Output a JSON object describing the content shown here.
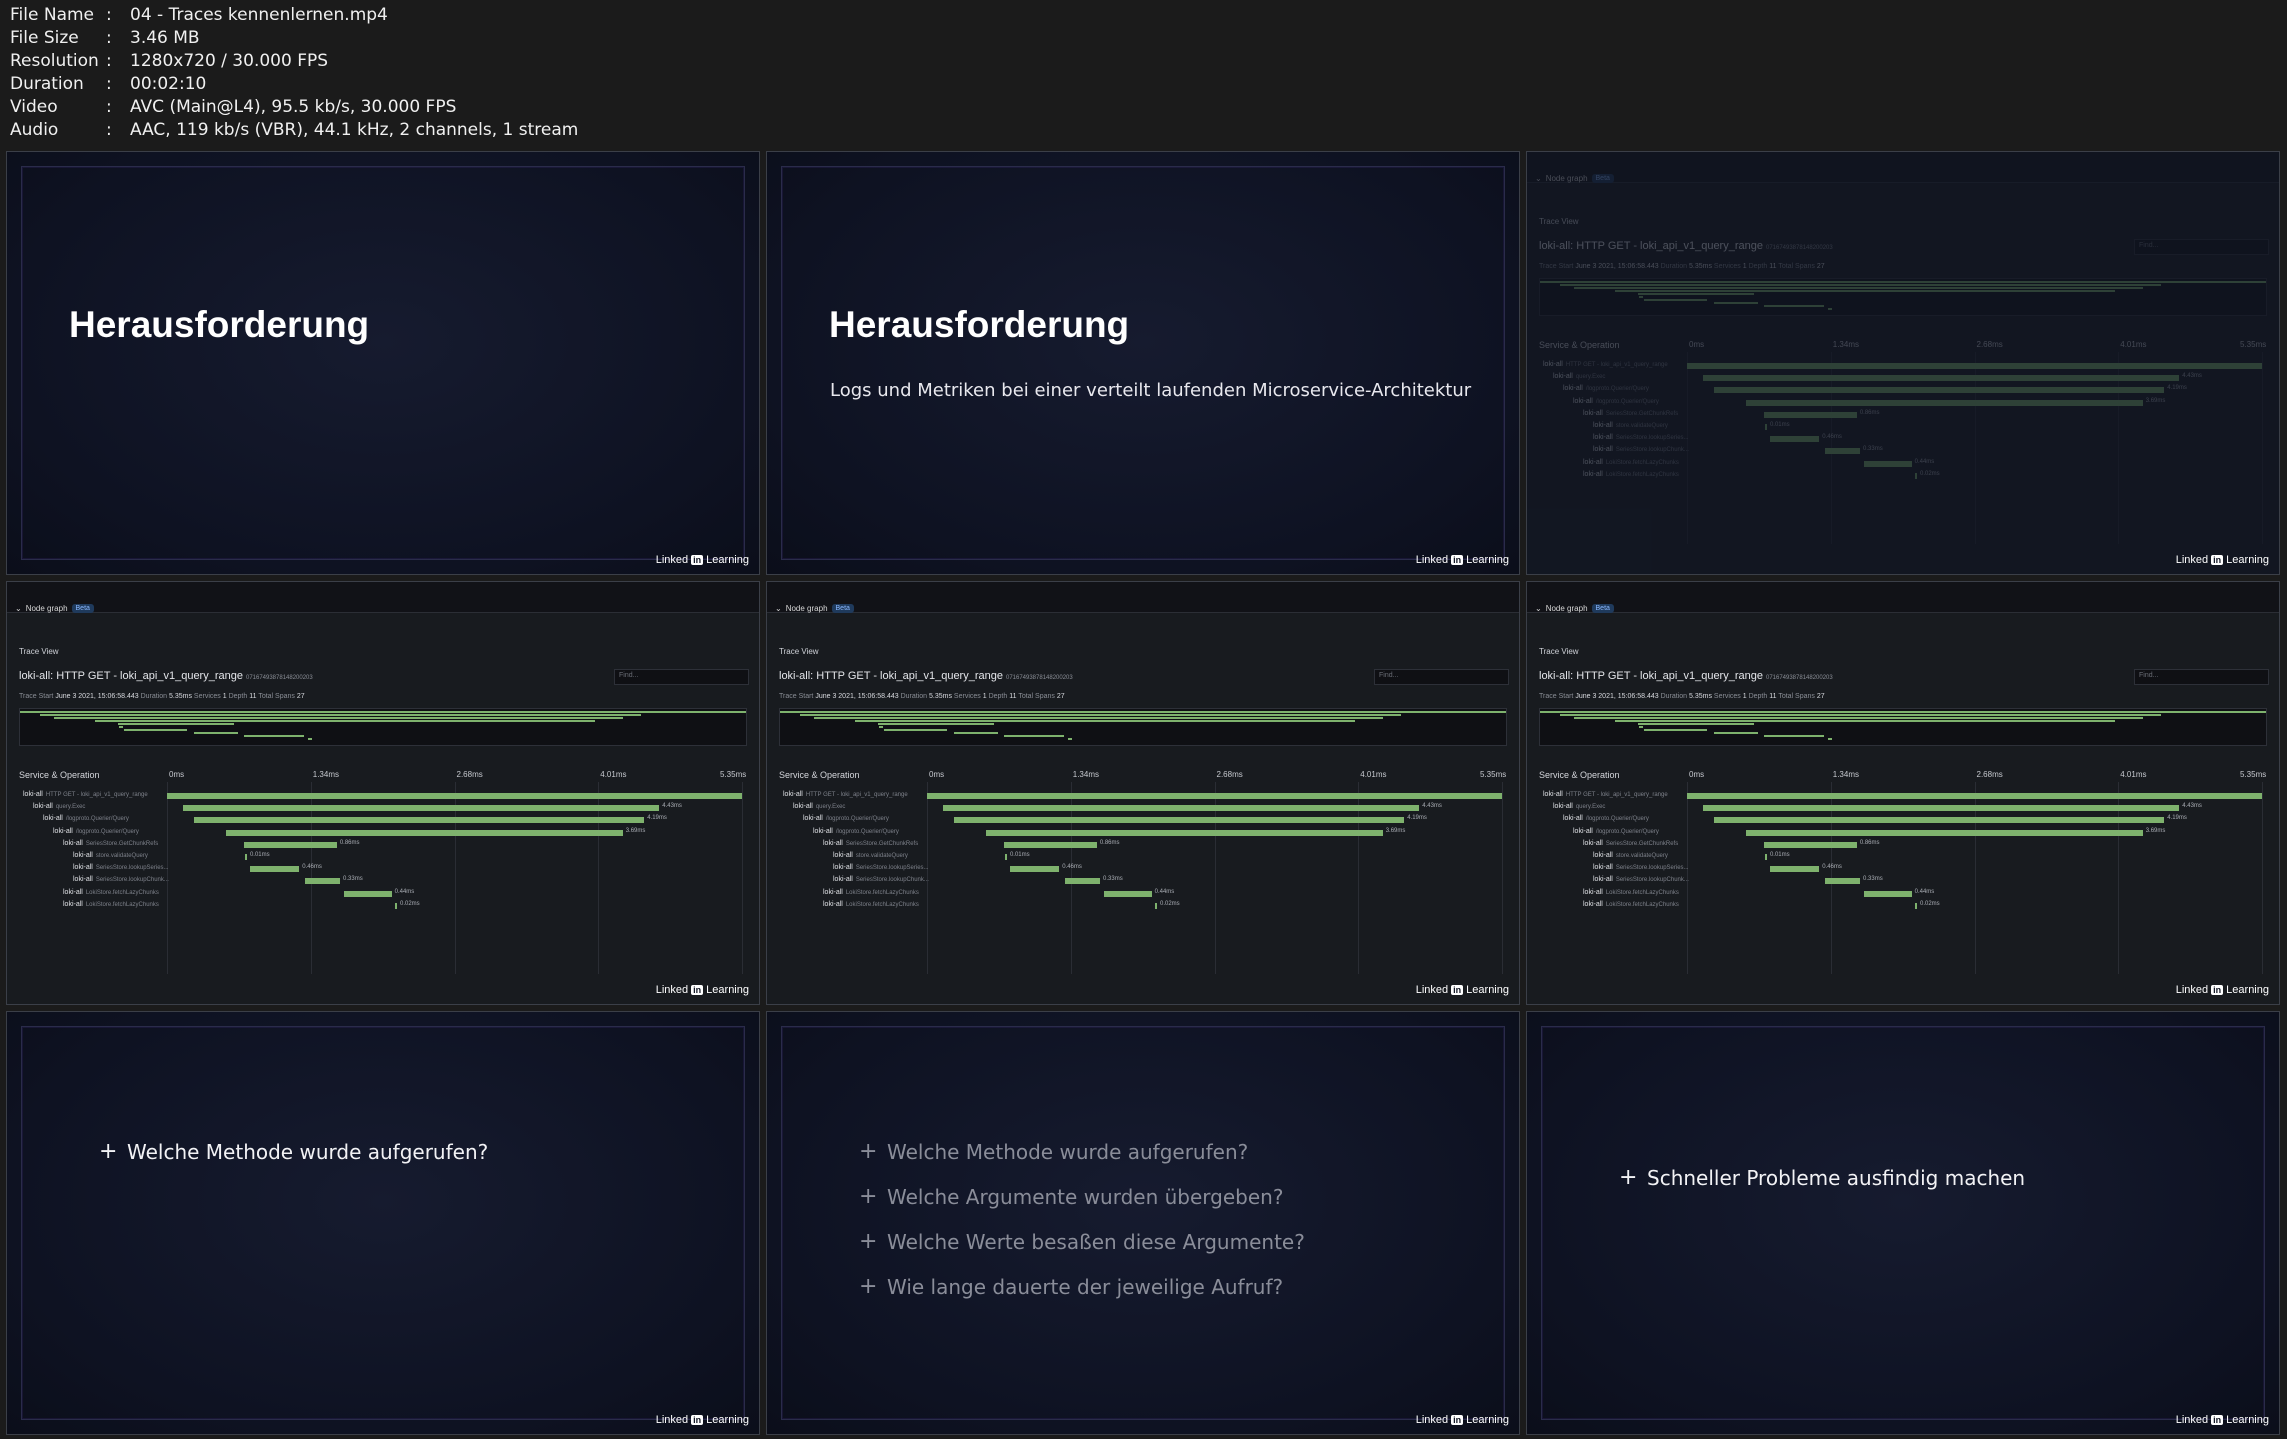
{
  "meta": {
    "rows": [
      {
        "key": "File Name",
        "sep": ":",
        "value": "04 - Traces kennenlernen.mp4"
      },
      {
        "key": "File Size",
        "sep": ":",
        "value": "3.46 MB"
      },
      {
        "key": "Resolution",
        "sep": ":",
        "value": "1280x720 / 30.000 FPS"
      },
      {
        "key": "Duration",
        "sep": ":",
        "value": "00:02:10"
      },
      {
        "key": "Video",
        "sep": ":",
        "value": "AVC (Main@L4), 95.5 kb/s, 30.000 FPS"
      },
      {
        "key": "Audio",
        "sep": ":",
        "value": "AAC, 119 kb/s (VBR), 44.1 kHz, 2 channels, 1 stream"
      }
    ]
  },
  "brand": {
    "pre": "Linked",
    "in": "in",
    "post": "Learning"
  },
  "slides": {
    "s1": {
      "heading": "Herausforderung"
    },
    "s2": {
      "heading": "Herausforderung",
      "subtitle": "Logs und Metriken bei einer verteilt laufenden Microservice-Architektur"
    },
    "s7": {
      "bullets": [
        "Welche Methode wurde aufgerufen?"
      ]
    },
    "s8": {
      "bullets": [
        "Welche Methode wurde aufgerufen?",
        "Welche Argumente wurden übergeben?",
        "Welche Werte besaßen diese Argumente?",
        "Wie lange dauerte der jeweilige Aufruf?"
      ]
    },
    "s9": {
      "bullets": [
        "Schneller Probleme ausfindig machen"
      ]
    }
  },
  "trace": {
    "node_graph": "Node graph",
    "beta": "Beta",
    "label": "Trace View",
    "title": "loki-all: HTTP GET - loki_api_v1_query_range",
    "trace_id": "07167493878148200203",
    "find_placeholder": "Find...",
    "stats": {
      "start_label": "Trace Start",
      "start": "June 3 2021, 15:06:58.443",
      "duration_label": "Duration",
      "duration": "5.35ms",
      "services_label": "Services",
      "services": "1",
      "depth_label": "Depth",
      "depth": "11",
      "spans_label": "Total Spans",
      "spans": "27"
    },
    "service_op": "Service & Operation",
    "ticks": [
      "0ms",
      "1.34ms",
      "2.68ms",
      "4.01ms",
      "5.35ms"
    ],
    "rows": [
      {
        "svc": "loki-all",
        "op": "HTTP GET - loki_api_v1_query_range",
        "start": 0.0,
        "dur": 5.35,
        "label": ""
      },
      {
        "svc": "loki-all",
        "op": "query.Exec",
        "start": 0.15,
        "dur": 4.43,
        "label": "4.43ms"
      },
      {
        "svc": "loki-all",
        "op": "/logproto.Querier/Query",
        "start": 0.25,
        "dur": 4.19,
        "label": "4.19ms"
      },
      {
        "svc": "loki-all",
        "op": "/logproto.Querier/Query",
        "start": 0.55,
        "dur": 3.69,
        "label": "3.69ms"
      },
      {
        "svc": "loki-all",
        "op": "SeriesStore.GetChunkRefs",
        "start": 0.72,
        "dur": 0.86,
        "label": "0.86ms"
      },
      {
        "svc": "loki-all",
        "op": "store.validateQuery",
        "start": 0.73,
        "dur": 0.01,
        "label": "0.01ms"
      },
      {
        "svc": "loki-all",
        "op": "SeriesStore.lookupSeries...",
        "start": 0.77,
        "dur": 0.46,
        "label": "0.46ms"
      },
      {
        "svc": "loki-all",
        "op": "SeriesStore.lookupChunk...",
        "start": 1.28,
        "dur": 0.33,
        "label": "0.33ms"
      },
      {
        "svc": "loki-all",
        "op": "LokiStore.fetchLazyChunks",
        "start": 1.65,
        "dur": 0.44,
        "label": "0.44ms"
      },
      {
        "svc": "loki-all",
        "op": "LokiStore.fetchLazyChunks",
        "start": 2.12,
        "dur": 0.02,
        "label": "0.02ms"
      }
    ]
  }
}
